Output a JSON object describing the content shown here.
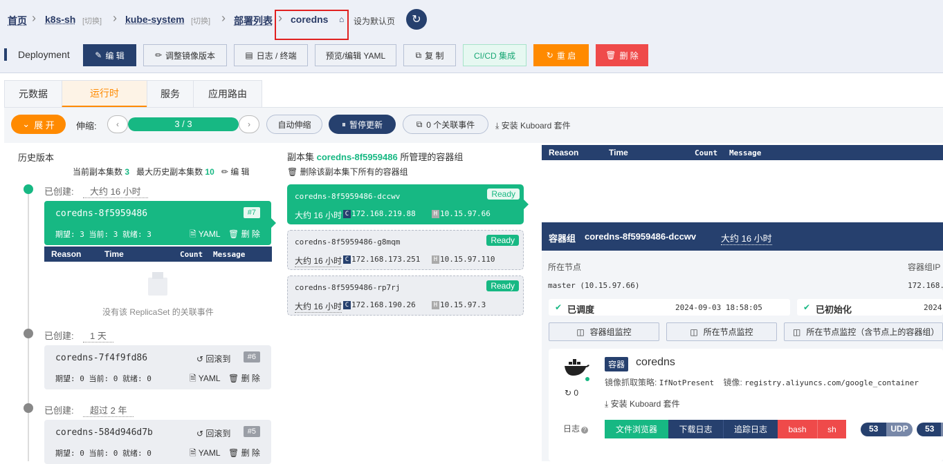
{
  "breadcrumb": {
    "home": "首页",
    "cluster": "k8s-sh",
    "switch": "[切换]",
    "namespace": "kube-system",
    "list": "部署列表",
    "current": "coredns",
    "set_default": "设为默认页"
  },
  "header": {
    "kind": "Deployment"
  },
  "actions": {
    "edit": "编 辑",
    "adjust_image": "调整镜像版本",
    "logs": "日志 / 终端",
    "yaml": "预览/编辑 YAML",
    "copy": "复 制",
    "cicd": "CI/CD 集成",
    "restart": "重 启",
    "delete": "删 除"
  },
  "tabs": [
    "元数据",
    "运行时",
    "服务",
    "应用路由"
  ],
  "toolbar": {
    "expand": "展 开",
    "scale_label": "伸缩:",
    "replicas": "3 / 3",
    "replicas_fraction": 1.0,
    "autoscale": "自动伸缩",
    "pause": "暂停更新",
    "events": "0 个关联事件",
    "install": "安装 Kuboard 套件"
  },
  "history": {
    "title": "历史版本",
    "current_label": "当前副本集数",
    "current_value": "3",
    "max_label": "最大历史副本集数",
    "max_value": "10",
    "edit": "编 辑",
    "created_label": "已创建:",
    "empty_events": "没有该 ReplicaSet 的关联事件",
    "yaml": "YAML",
    "delete": "删 除",
    "rollback": "回滚到",
    "items": [
      {
        "age": "大约 16 小时",
        "name": "coredns-8f5959486",
        "rev": "#7",
        "stats": "期望: 3 当前: 3 就绪: 3"
      },
      {
        "age": "1 天",
        "name": "coredns-7f4f9fd86",
        "rev": "#6",
        "stats": "期望: 0 当前: 0 就绪: 0"
      },
      {
        "age": "超过 2 年",
        "name": "coredns-584d946d7b",
        "rev": "#5",
        "stats": "期望: 0 当前: 0 就绪: 0"
      }
    ]
  },
  "events_table": {
    "headers": [
      "Reason",
      "Time",
      "Count",
      "Message"
    ]
  },
  "replicaset": {
    "prefix": "副本集",
    "name": "coredns-8f5959486",
    "suffix": "所管理的容器组",
    "delete_all": "删除该副本集下所有的容器组",
    "pods": [
      {
        "name": "coredns-8f5959486-dccwv",
        "status": "Ready",
        "age": "大约 16 小时",
        "pod_ip": "172.168.219.88",
        "host_ip": "10.15.97.66"
      },
      {
        "name": "coredns-8f5959486-g8mqm",
        "status": "Ready",
        "age": "大约 16 小时",
        "pod_ip": "172.168.173.251",
        "host_ip": "10.15.97.110"
      },
      {
        "name": "coredns-8f5959486-rp7rj",
        "status": "Ready",
        "age": "大约 16 小时",
        "pod_ip": "172.168.190.26",
        "host_ip": "10.15.97.3"
      }
    ],
    "c_badge": "C",
    "h_badge": "H"
  },
  "pod_detail": {
    "title_prefix": "容器组",
    "name": "coredns-8f5959486-dccwv",
    "age": "大约 16 小时",
    "node_label": "所在节点",
    "pod_ip_label": "容器组IP",
    "node_value": "master (10.15.97.66)",
    "pod_ip_value": "172.168.",
    "scheduled": "已调度",
    "scheduled_time": "2024-09-03 18:58:05",
    "initialized": "已初始化",
    "initialized_time": "2024",
    "monitor_pod": "容器组监控",
    "monitor_node": "所在节点监控",
    "monitor_node_all": "所在节点监控（含节点上的容器组）"
  },
  "container": {
    "tag": "容器",
    "name": "coredns",
    "pull_policy_label": "镜像抓取策略:",
    "pull_policy": "IfNotPresent",
    "image_label": "镜像:",
    "image": "registry.aliyuncs.com/google_container",
    "restarts": "0",
    "install": "安装 Kuboard 套件",
    "logs_label": "日志",
    "buttons": [
      "文件浏览器",
      "下载日志",
      "追踪日志",
      "bash",
      "sh"
    ],
    "ports": [
      {
        "num": "53",
        "proto": "UDP"
      },
      {
        "num": "53",
        "proto": ""
      }
    ]
  },
  "colors": {
    "primary": "#26406e",
    "green": "#17b883",
    "orange": "#ff8a00",
    "red": "#ef4a4a"
  }
}
